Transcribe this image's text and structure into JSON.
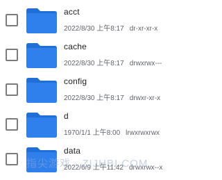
{
  "colors": {
    "folder_body": "#1f6fd6",
    "folder_tab": "#2f80ed",
    "checkbox_border": "#7b7b7b"
  },
  "files": [
    {
      "icon": "folder-icon",
      "name": "acct",
      "date": "2022/8/30 上午8:17",
      "perm": "dr-xr-xr-x"
    },
    {
      "icon": "folder-icon",
      "name": "cache",
      "date": "2022/8/30 上午8:17",
      "perm": "drwxrwx---"
    },
    {
      "icon": "folder-icon",
      "name": "config",
      "date": "2022/8/30 上午8:17",
      "perm": "drwxr-xr-x"
    },
    {
      "icon": "folder-icon",
      "name": "d",
      "date": "1970/1/1 上午8:00",
      "perm": "lrwxrwxrwx"
    },
    {
      "icon": "folder-icon",
      "name": "data",
      "date": "2022/6/9 上午11:42",
      "perm": "drwxrwx--x"
    }
  ],
  "watermark": "指尖游戏 · ZIJHBI.COM"
}
